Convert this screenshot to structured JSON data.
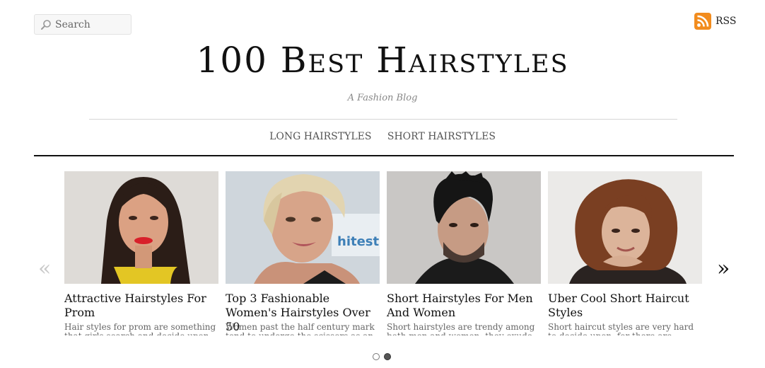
{
  "header": {
    "search_placeholder": "Search",
    "rss_label": "RSS",
    "site_title": "100 Best Hairstyles",
    "tagline": "A Fashion Blog"
  },
  "nav": {
    "items": [
      {
        "label": "LONG HAIRSTYLES"
      },
      {
        "label": "SHORT HAIRSTYLES"
      }
    ]
  },
  "carousel": {
    "prev_glyph": "«",
    "next_glyph": "»",
    "cards": [
      {
        "title": "Attractive Hairstyles For Prom",
        "excerpt": "Hair styles for prom are something that girls search and decide upon well"
      },
      {
        "title": "Top 3 Fashionable Women's Hairstyles Over 50",
        "excerpt": "Women past the half century mark tend to undergo the scissors as an"
      },
      {
        "title": "Short Hairstyles For Men And Women",
        "excerpt": "Short hairstyles are trendy among both men and women; they exude"
      },
      {
        "title": "Uber Cool Short Haircut Styles",
        "excerpt": "Short haircut styles are very hard to decide upon, for there are various"
      }
    ],
    "pagination": {
      "total": 2,
      "active": 2
    }
  },
  "colors": {
    "rss_orange": "#f28c1e",
    "divider_dark": "#111111",
    "accent_red": "#d8202a"
  }
}
